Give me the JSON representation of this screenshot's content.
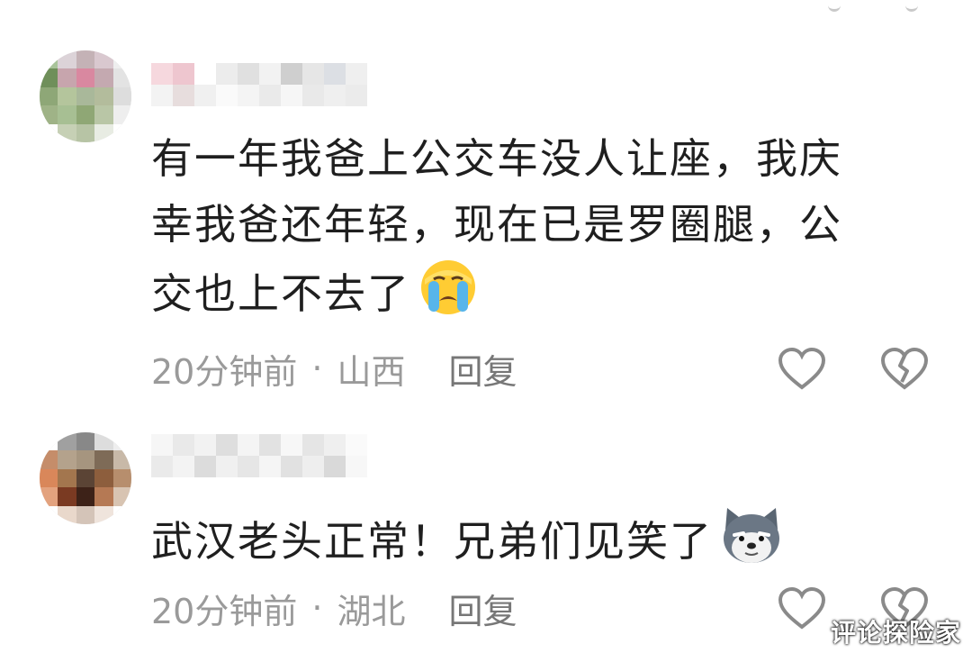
{
  "comments": [
    {
      "text_lines": [
        "有一年我爸上公交车没人让座，我庆",
        "幸我爸还年轻，现在已是罗圈腿，公",
        "交也上不去了"
      ],
      "emoji": "crying-face",
      "time": "20分钟前",
      "separator": "·",
      "location": "山西",
      "reply_label": "回复"
    },
    {
      "text_lines": [
        "武汉老头正常！兄弟们见笑了"
      ],
      "emoji": "dog-face",
      "time": "20分钟前",
      "separator": "·",
      "location": "湖北",
      "reply_label": "回复"
    }
  ],
  "icons": {
    "like": "heart-outline-icon",
    "dislike": "broken-heart-outline-icon"
  },
  "watermark": "评论探险家",
  "colors": {
    "text": "#1f1f1f",
    "meta": "#9a9a9a",
    "icon": "#8a8a8a"
  }
}
